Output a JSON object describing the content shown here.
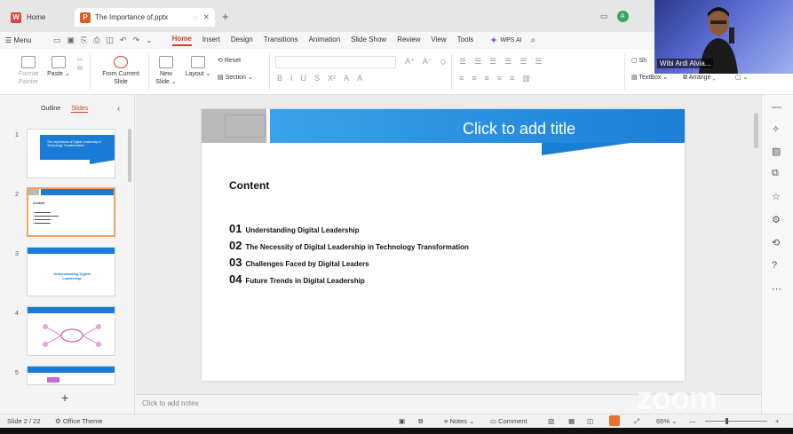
{
  "tabs": {
    "home": "Home",
    "doc": "The Importance of.pptx"
  },
  "user_initial": "A",
  "menu": {
    "label": "Menu",
    "tabs": [
      "Home",
      "Insert",
      "Design",
      "Transitions",
      "Animation",
      "Slide Show",
      "Review",
      "View",
      "Tools"
    ],
    "wps_ai": "WPS AI"
  },
  "ribbon": {
    "format_painter": "Format Painter",
    "paste": "Paste",
    "from_current": "From Current Slide",
    "new_slide": "New Slide",
    "layout": "Layout",
    "reset": "Reset",
    "section": "Section",
    "textbox": "TextBox",
    "arrange": "Arrange",
    "sh": "Sh"
  },
  "left_panel": {
    "outline": "Outline",
    "slides": "Slides",
    "thumb_numbers": [
      "1",
      "2",
      "3",
      "4",
      "5"
    ]
  },
  "thumbs": {
    "t1": "The Importance of Digital Leadership in Technology Transformation",
    "t3": "Understanding Digital Leadership"
  },
  "slide": {
    "title": "Click to add title",
    "heading": "Content",
    "items": [
      {
        "num": "01",
        "text": "Understanding Digital Leadership"
      },
      {
        "num": "02",
        "text": "The Necessity of Digital Leadership in Technology Transformation"
      },
      {
        "num": "03",
        "text": "Challenges Faced by Digital Leaders"
      },
      {
        "num": "04",
        "text": "Future Trends in Digital Leadership"
      }
    ]
  },
  "notes_placeholder": "Click to add notes",
  "status": {
    "slide_count": "Slide 2 / 22",
    "theme": "Office Theme",
    "notes": "Notes",
    "comment": "Comment",
    "zoom": "65%"
  },
  "webcam": {
    "name": "Wibi Ardi Alvia..."
  },
  "zoom_watermark": "zoom",
  "colors": {
    "accent": "#d83c2a",
    "slide_blue": "#1b7fd6",
    "thumb_selected": "#f0a35a"
  }
}
